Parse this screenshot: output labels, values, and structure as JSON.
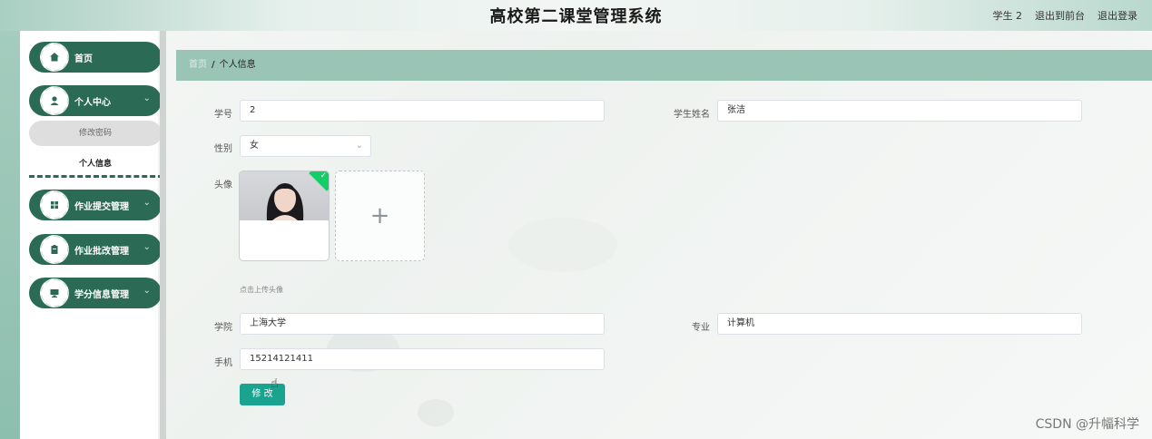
{
  "header": {
    "title": "高校第二课堂管理系统",
    "user": "学生 2",
    "to_front": "退出到前台",
    "logout": "退出登录"
  },
  "sidebar": {
    "items": [
      {
        "label": "首页",
        "icon": "home-icon"
      },
      {
        "label": "个人中心",
        "icon": "user-icon"
      },
      {
        "label": "作业提交管理",
        "icon": "grid-icon"
      },
      {
        "label": "作业批改管理",
        "icon": "clipboard-icon"
      },
      {
        "label": "学分信息管理",
        "icon": "monitor-icon"
      }
    ],
    "subitems": [
      {
        "label": "修改密码"
      },
      {
        "label": "个人信息"
      }
    ]
  },
  "breadcrumb": {
    "home": "首页",
    "separator": "/",
    "current": "个人信息"
  },
  "form": {
    "student_id_label": "学号",
    "student_id_value": "2",
    "name_label": "学生姓名",
    "name_value": "张洁",
    "gender_label": "性别",
    "gender_value": "女",
    "avatar_label": "头像",
    "upload_plus": "+",
    "upload_hint": "点击上传头像",
    "college_label": "学院",
    "college_value": "上海大学",
    "major_label": "专业",
    "major_value": "计算机",
    "phone_label": "手机",
    "phone_value": "15214121411",
    "submit_label": "修 改"
  },
  "watermark": "CSDN @升幅科学",
  "colors": {
    "sidebar_green": "#2b6b55",
    "breadcrumb_bg": "#9ac5b6",
    "button": "#1aa48f"
  }
}
